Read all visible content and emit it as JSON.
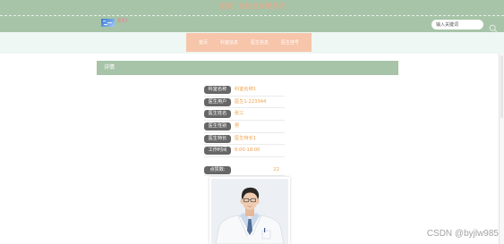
{
  "app": {
    "title": "医院门诊信息管理系统"
  },
  "header": {
    "user": {
      "name": "医生1"
    },
    "search": {
      "placeholder": "输入关键词",
      "value": ""
    }
  },
  "nav": {
    "items": [
      {
        "label": "首页"
      },
      {
        "label": "科室信息"
      },
      {
        "label": "医生信息"
      },
      {
        "label": "医生挂号"
      }
    ]
  },
  "detail": {
    "heading": "详情",
    "fields": [
      {
        "label": "科室名称",
        "value": "科室名称1"
      },
      {
        "label": "医生用户",
        "value": "医生1-223344"
      },
      {
        "label": "医生姓名",
        "value": "张三"
      },
      {
        "label": "医生性别",
        "value": "男"
      },
      {
        "label": "医生特长",
        "value": "医生特长1"
      },
      {
        "label": "工作时间",
        "value": "8:00-18:00"
      }
    ],
    "likes": {
      "label": "点赞数:",
      "value": "22"
    }
  },
  "watermark": "CSDN @byjlw985",
  "icons": {
    "avatar": "avatar-image",
    "search": "search-icon",
    "photo": "doctor-photo"
  },
  "colors": {
    "header_bg": "#a7c4a8",
    "title_text": "#f0a487",
    "nav_band_bg": "#eef7f3",
    "nav_bg": "#f6c5aa",
    "label_badge_bg": "#676767",
    "value_text": "#f0a04b"
  }
}
